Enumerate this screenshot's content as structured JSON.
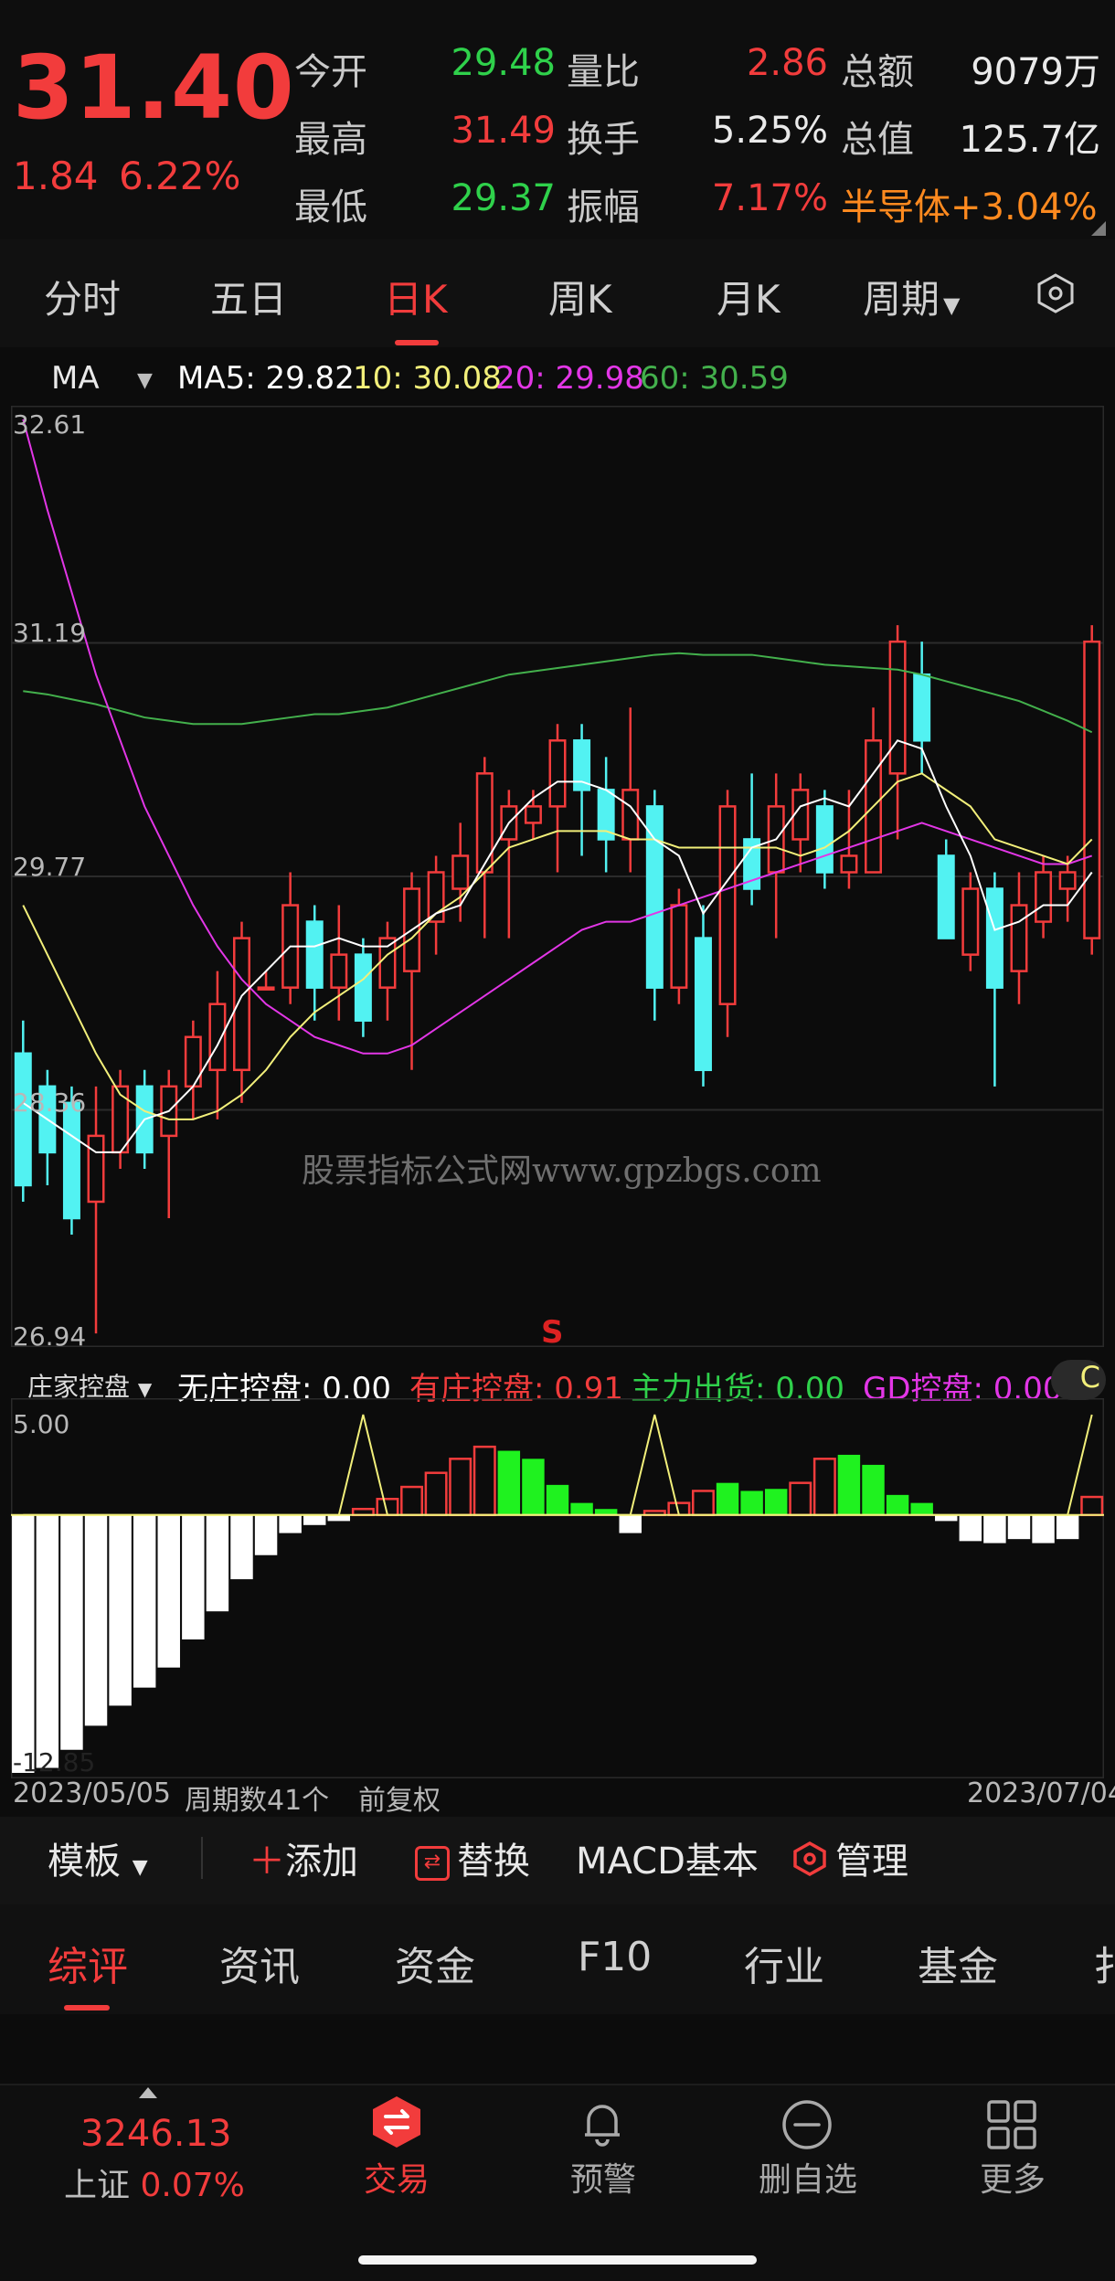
{
  "header": {
    "price": "31.40",
    "change": "1.84",
    "change_pct": "6.22%",
    "stats": [
      {
        "label": "今开",
        "value": "29.48",
        "color": "green"
      },
      {
        "label": "最高",
        "value": "31.49",
        "color": "red"
      },
      {
        "label": "最低",
        "value": "29.37",
        "color": "green"
      },
      {
        "label": "量比",
        "value": "2.86",
        "color": "red"
      },
      {
        "label": "换手",
        "value": "5.25%",
        "color": "white"
      },
      {
        "label": "振幅",
        "value": "7.17%",
        "color": "red"
      },
      {
        "label": "总额",
        "value": "9079万",
        "color": "white"
      },
      {
        "label": "总值",
        "value": "125.7亿",
        "color": "white"
      }
    ],
    "sector": "半导体",
    "sector_change": "+3.04%"
  },
  "period_tabs": [
    "分时",
    "五日",
    "日K",
    "周K",
    "月K",
    "周期"
  ],
  "active_period": "日K",
  "ma_row": {
    "selector": "MA",
    "ma5": "MA5: 29.82",
    "ma10": "10: 30.08",
    "ma20": "20: 29.98",
    "ma60": "60: 30.59"
  },
  "colors": {
    "up": "#f23c3c",
    "down": "#52f2f2",
    "ma5": "#ffffff",
    "ma10": "#f2ef7a",
    "ma20": "#e236e6",
    "ma60": "#43b04c"
  },
  "kline_axis": [
    "32.61",
    "31.19",
    "29.77",
    "28.36",
    "26.94"
  ],
  "signal_marker": "S",
  "watermark": "股票指标公式网www.gpzbgs.com",
  "indicator_row": {
    "name": "庄家控盘",
    "item1": "无庄控盘: 0.00",
    "item2": "有庄控盘: 0.91",
    "item3": "主力出货: 0.00",
    "item4": "GD控盘: 0.00",
    "corner": "C"
  },
  "indicator_axis": [
    "5.00",
    "-12.85"
  ],
  "date_row": {
    "start": "2023/05/05",
    "periods": "周期数41个",
    "adjust": "前复权",
    "end": "2023/07/04"
  },
  "toolbar": {
    "template": "模板",
    "add": "添加",
    "replace": "替换",
    "macd": "MACD基本",
    "manage": "管理"
  },
  "info_tabs": [
    "综评",
    "资讯",
    "资金",
    "F10",
    "行业",
    "基金",
    "扌"
  ],
  "bottom_nav": {
    "index_value": "3246.13",
    "index_name": "上证",
    "index_change": "0.07%",
    "items": [
      "交易",
      "预警",
      "删自选",
      "更多"
    ]
  },
  "chart_data": {
    "type": "candlestick",
    "y_range": [
      26.94,
      32.61
    ],
    "candles": [
      [
        28.7,
        27.9,
        28.9,
        27.8
      ],
      [
        28.5,
        28.1,
        28.6,
        27.9
      ],
      [
        28.4,
        27.7,
        28.5,
        27.6
      ],
      [
        27.8,
        28.2,
        28.5,
        27.0
      ],
      [
        28.1,
        28.5,
        28.6,
        28.0
      ],
      [
        28.5,
        28.1,
        28.6,
        28.0
      ],
      [
        28.2,
        28.5,
        28.6,
        27.7
      ],
      [
        28.5,
        28.8,
        28.9,
        28.3
      ],
      [
        28.6,
        29.0,
        29.2,
        28.3
      ],
      [
        28.6,
        29.4,
        29.5,
        28.4
      ],
      [
        29.1,
        29.1,
        29.2,
        29.1
      ],
      [
        29.1,
        29.6,
        29.8,
        29.0
      ],
      [
        29.5,
        29.1,
        29.6,
        28.9
      ],
      [
        29.1,
        29.3,
        29.6,
        28.9
      ],
      [
        29.3,
        28.9,
        29.4,
        28.8
      ],
      [
        29.1,
        29.4,
        29.5,
        28.9
      ],
      [
        29.2,
        29.7,
        29.8,
        28.6
      ],
      [
        29.5,
        29.8,
        29.9,
        29.3
      ],
      [
        29.7,
        29.9,
        30.1,
        29.5
      ],
      [
        29.8,
        30.4,
        30.5,
        29.4
      ],
      [
        30.0,
        30.2,
        30.3,
        29.4
      ],
      [
        30.1,
        30.2,
        30.3,
        30.0
      ],
      [
        30.2,
        30.6,
        30.7,
        29.8
      ],
      [
        30.6,
        30.3,
        30.7,
        29.9
      ],
      [
        30.3,
        30.0,
        30.5,
        29.8
      ],
      [
        30.0,
        30.3,
        30.8,
        29.8
      ],
      [
        30.2,
        29.1,
        30.3,
        28.9
      ],
      [
        29.1,
        29.6,
        29.7,
        29.0
      ],
      [
        29.4,
        28.6,
        29.6,
        28.5
      ],
      [
        29.0,
        30.2,
        30.3,
        28.8
      ],
      [
        30.0,
        29.7,
        30.4,
        29.6
      ],
      [
        29.8,
        30.2,
        30.4,
        29.4
      ],
      [
        30.0,
        30.3,
        30.4,
        29.8
      ],
      [
        30.2,
        29.8,
        30.3,
        29.7
      ],
      [
        29.8,
        29.9,
        30.3,
        29.7
      ],
      [
        29.8,
        30.6,
        30.8,
        29.8
      ],
      [
        30.4,
        31.2,
        31.3,
        30.0
      ],
      [
        31.0,
        30.6,
        31.2,
        30.4
      ],
      [
        29.9,
        29.4,
        30.0,
        29.4
      ],
      [
        29.3,
        29.7,
        29.8,
        29.2
      ],
      [
        29.7,
        29.1,
        29.8,
        28.5
      ],
      [
        29.2,
        29.6,
        29.8,
        29.0
      ],
      [
        29.5,
        29.8,
        29.9,
        29.4
      ],
      [
        29.7,
        29.8,
        29.9,
        29.5
      ],
      [
        29.4,
        31.2,
        31.3,
        29.3
      ]
    ],
    "ma5": [
      28.4,
      28.3,
      28.2,
      28.1,
      28.1,
      28.3,
      28.35,
      28.5,
      28.75,
      29.05,
      29.2,
      29.35,
      29.35,
      29.4,
      29.35,
      29.35,
      29.45,
      29.55,
      29.6,
      29.85,
      30.1,
      30.25,
      30.35,
      30.35,
      30.3,
      30.2,
      30.0,
      29.9,
      29.55,
      29.75,
      29.95,
      30.0,
      30.2,
      30.25,
      30.2,
      30.4,
      30.6,
      30.55,
      30.2,
      29.9,
      29.45,
      29.5,
      29.6,
      29.6,
      29.8
    ],
    "ma10": [
      29.6,
      29.3,
      29.0,
      28.7,
      28.45,
      28.35,
      28.3,
      28.3,
      28.35,
      28.45,
      28.6,
      28.8,
      28.95,
      29.05,
      29.15,
      29.3,
      29.4,
      29.55,
      29.65,
      29.8,
      29.95,
      30.0,
      30.05,
      30.05,
      30.05,
      30.0,
      30.0,
      29.95,
      29.95,
      29.95,
      29.95,
      29.95,
      29.9,
      29.95,
      30.05,
      30.2,
      30.35,
      30.4,
      30.3,
      30.2,
      30.0,
      29.95,
      29.9,
      29.85,
      30.0
    ],
    "ma20": [
      32.55,
      32.0,
      31.5,
      31.0,
      30.6,
      30.2,
      29.9,
      29.6,
      29.35,
      29.15,
      29.0,
      28.9,
      28.8,
      28.75,
      28.7,
      28.7,
      28.75,
      28.85,
      28.95,
      29.05,
      29.15,
      29.25,
      29.35,
      29.45,
      29.5,
      29.5,
      29.55,
      29.6,
      29.65,
      29.7,
      29.75,
      29.8,
      29.85,
      29.9,
      29.95,
      30.0,
      30.05,
      30.1,
      30.05,
      30.0,
      29.95,
      29.9,
      29.85,
      29.85,
      29.9
    ],
    "ma60": [
      30.9,
      30.88,
      30.85,
      30.82,
      30.78,
      30.74,
      30.72,
      30.7,
      30.7,
      30.7,
      30.72,
      30.74,
      30.76,
      30.76,
      30.78,
      30.8,
      30.84,
      30.88,
      30.92,
      30.96,
      31.0,
      31.02,
      31.04,
      31.06,
      31.08,
      31.1,
      31.12,
      31.13,
      31.12,
      31.12,
      31.12,
      31.1,
      31.08,
      31.06,
      31.05,
      31.04,
      31.03,
      31.0,
      30.96,
      30.92,
      30.88,
      30.84,
      30.78,
      30.72,
      30.65
    ],
    "indicator_bars": [
      -12.85,
      -12.6,
      -11.7,
      -10.5,
      -9.5,
      -8.6,
      -7.6,
      -6.2,
      -4.8,
      -3.2,
      -2.0,
      -0.9,
      -0.5,
      -0.3,
      0.3,
      0.8,
      1.4,
      2.1,
      2.8,
      3.4,
      3.2,
      2.8,
      1.5,
      0.6,
      0.3,
      -0.9,
      0.2,
      0.6,
      1.2,
      1.6,
      1.2,
      1.3,
      1.6,
      2.8,
      3.0,
      2.5,
      1.0,
      0.6,
      -0.3,
      -1.3,
      -1.4,
      -1.2,
      -1.4,
      -1.2,
      0.9
    ],
    "indicator_bar_colors": [
      "w",
      "w",
      "w",
      "w",
      "w",
      "w",
      "w",
      "w",
      "w",
      "w",
      "w",
      "w",
      "w",
      "w",
      "r",
      "r",
      "r",
      "r",
      "r",
      "r",
      "g",
      "g",
      "g",
      "g",
      "g",
      "w",
      "r",
      "r",
      "r",
      "g",
      "g",
      "g",
      "r",
      "r",
      "g",
      "g",
      "g",
      "g",
      "w",
      "w",
      "w",
      "w",
      "w",
      "w",
      "r"
    ],
    "indicator_line": [
      0,
      0,
      0,
      0,
      0,
      0,
      0,
      0,
      0,
      0,
      0,
      0,
      0,
      0,
      5.0,
      0,
      0,
      0,
      0,
      0,
      0,
      0,
      0,
      0,
      0,
      0,
      5.0,
      0,
      0,
      0,
      0,
      0,
      0,
      0,
      0,
      0,
      0,
      0,
      0,
      0,
      0,
      0,
      0,
      0,
      5.0
    ],
    "indicator_range": [
      -12.85,
      5.0
    ]
  }
}
